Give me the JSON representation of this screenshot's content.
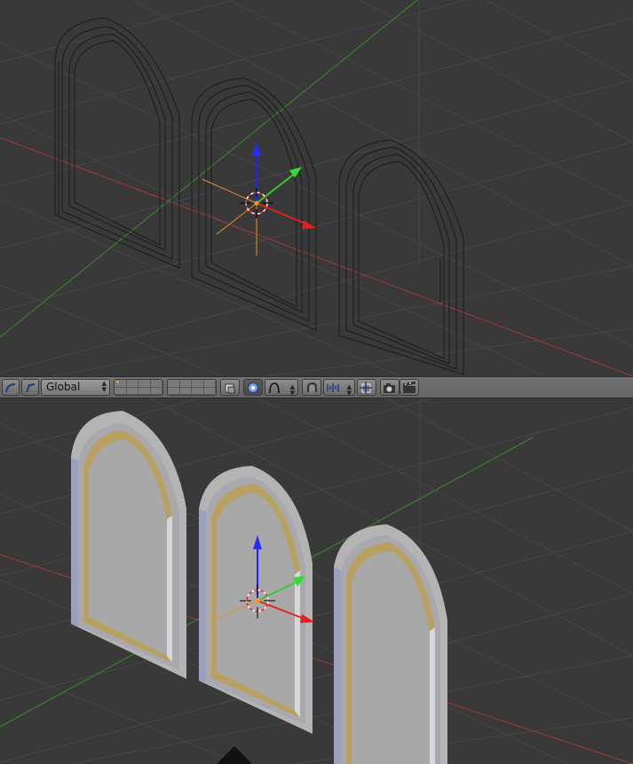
{
  "header": {
    "transform_orientation": "Global",
    "icons": [
      "curve-icon",
      "pivot-icon",
      "layer-grid-icon",
      "layer-grid-icon",
      "render-layer-icon",
      "proportional-edit-icon",
      "falloff-icon",
      "snap-icon",
      "snap-element-icon",
      "snap-target-icon",
      "opengl-render-icon",
      "opengl-anim-icon"
    ]
  },
  "viewports": {
    "top": {
      "shading": "wireframe"
    },
    "bottom": {
      "shading": "solid"
    }
  },
  "colors": {
    "background": "#393939",
    "grid": "#4a4a4a",
    "x_axis": "#a23a3a",
    "y_axis": "#3c8a2e",
    "frame_light": "#b4b4b4",
    "frame_shade": "#8f96b4",
    "glass": "#a8a8a8",
    "trim": "#b8a060"
  }
}
